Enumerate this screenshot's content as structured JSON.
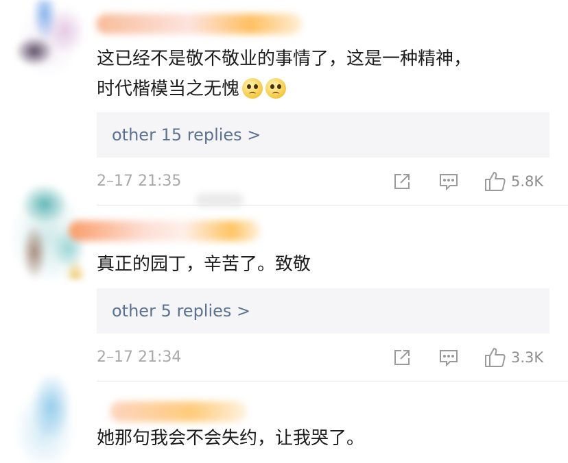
{
  "comments": [
    {
      "text_lines": [
        "这已经不是敬不敬业的事情了，这是一种精神，",
        "时代楷模当之无愧"
      ],
      "replies_label": "other 15 replies >",
      "time": "2–17 21:35",
      "likes": "5.8K"
    },
    {
      "text_lines": [
        "真正的园丁，辛苦了。致敬"
      ],
      "replies_label": "other 5 replies >",
      "time": "2–17 21:34",
      "likes": "3.3K"
    },
    {
      "text_lines": [
        "她那句我会不会失约，让我哭了。"
      ]
    }
  ],
  "icons": {
    "share": "share-icon",
    "comment": "comment-icon",
    "like": "thumbs-up-icon"
  },
  "colors": {
    "reply_link": "#5b7290",
    "reply_bg": "#f5f5f7",
    "meta": "#a8a8a8"
  }
}
